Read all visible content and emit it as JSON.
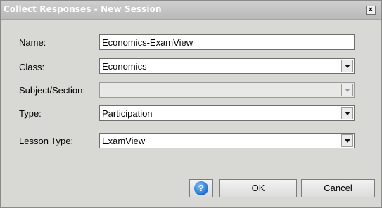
{
  "window": {
    "title": "Collect Responses - New Session",
    "close_glyph": "×"
  },
  "form": {
    "name": {
      "label": "Name:",
      "value": "Economics-ExamView"
    },
    "class": {
      "label": "Class:",
      "value": "Economics"
    },
    "subject": {
      "label": "Subject/Section:",
      "value": ""
    },
    "type": {
      "label": "Type:",
      "value": "Participation"
    },
    "lesson": {
      "label": "Lesson Type:",
      "value": "ExamView"
    }
  },
  "buttons": {
    "help_icon_glyph": "?",
    "ok": "OK",
    "cancel": "Cancel"
  },
  "icons": {
    "help": "help-icon",
    "close": "close-icon",
    "dropdown": "chevron-down-icon"
  },
  "colors": {
    "titlebar": "#c4c4c4",
    "dialog_bg": "#d8d8d4",
    "help_blue": "#1c6fd0"
  }
}
